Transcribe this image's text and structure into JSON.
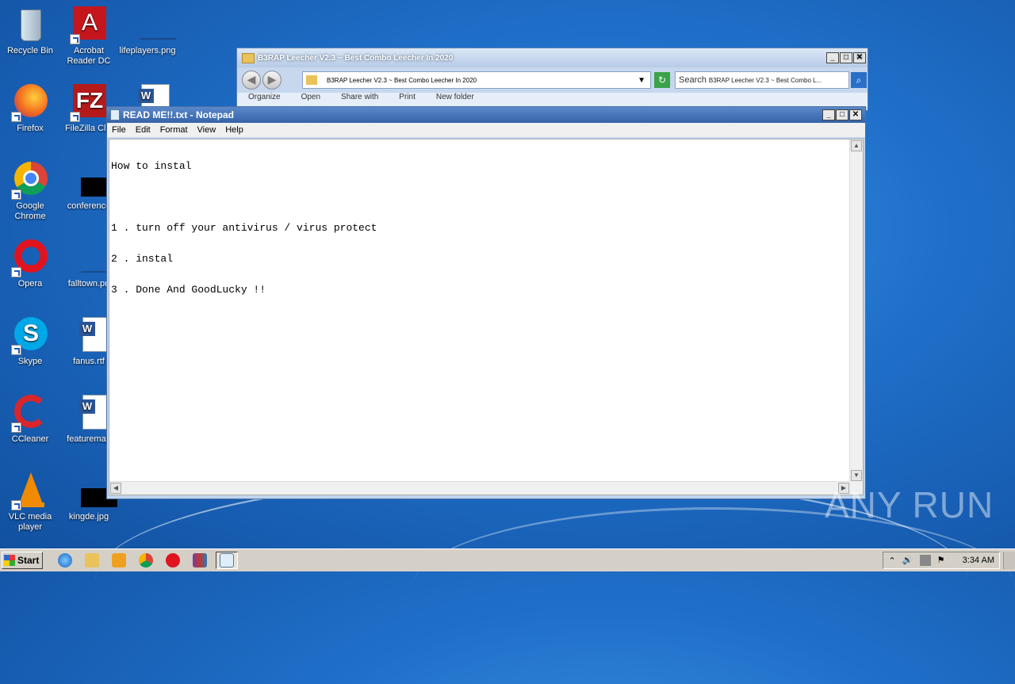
{
  "desktop": {
    "icons": [
      {
        "label": "Recycle Bin"
      },
      {
        "label": "Acrobat Reader DC"
      },
      {
        "label": "lifeplayers.png"
      },
      {
        "label": "Firefox"
      },
      {
        "label": "FileZilla Clie"
      },
      {
        "label": "Google Chrome"
      },
      {
        "label": "conference"
      },
      {
        "label": "Opera"
      },
      {
        "label": "falltown.pn"
      },
      {
        "label": "Skype"
      },
      {
        "label": "fanus.rtf"
      },
      {
        "label": "CCleaner"
      },
      {
        "label": "featuremap"
      },
      {
        "label": "VLC media player"
      },
      {
        "label": "kingde.jpg"
      }
    ]
  },
  "explorer": {
    "title": "B3RAP Leecher V2.3 ~ Best Combo Leecher In 2020",
    "address": "B3RAP Leecher V2.3 ~ Best Combo Leecher In 2020",
    "search_label": "Search",
    "search_term": "B3RAP Leecher V2.3 ~ Best Combo L...",
    "menu": [
      "Organize",
      "Open",
      "Share with",
      "Print",
      "New folder"
    ]
  },
  "notepad": {
    "title": "READ ME!!.txt - Notepad",
    "menu": [
      "File",
      "Edit",
      "Format",
      "View",
      "Help"
    ],
    "lines": [
      "How to instal",
      "",
      "1 . turn off your antivirus / virus protect",
      "2 . instal",
      "3 . Done And GoodLucky !!"
    ]
  },
  "watermark": "ANY RUN",
  "taskbar": {
    "start_label": "Start",
    "clock": "3:34 AM"
  }
}
